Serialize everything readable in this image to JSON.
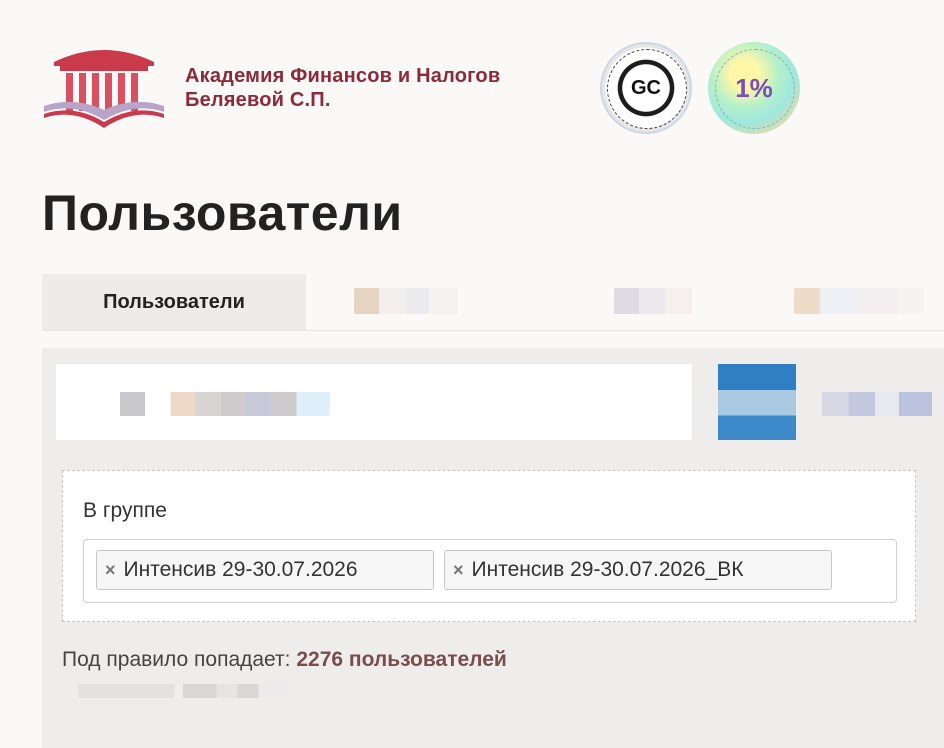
{
  "brand": {
    "name_line1": "Академия Финансов и Налогов",
    "name_line2": "Беляевой С.П.",
    "brand_color": "#8c2a3a",
    "badge_left_text": "GC",
    "badge_right_text": "1%"
  },
  "page": {
    "title": "Пользователи"
  },
  "tabs": {
    "active_label": "Пользователи"
  },
  "filter": {
    "label": "В группе",
    "tags": [
      {
        "label": "Интенсив 29-30.07.2026",
        "remove_icon": "×"
      },
      {
        "label": "Интенсив 29-30.07.2026_ВК",
        "remove_icon": "×"
      }
    ]
  },
  "rule": {
    "prefix": "Под правило попадает:",
    "count": "2276 пользователей"
  }
}
